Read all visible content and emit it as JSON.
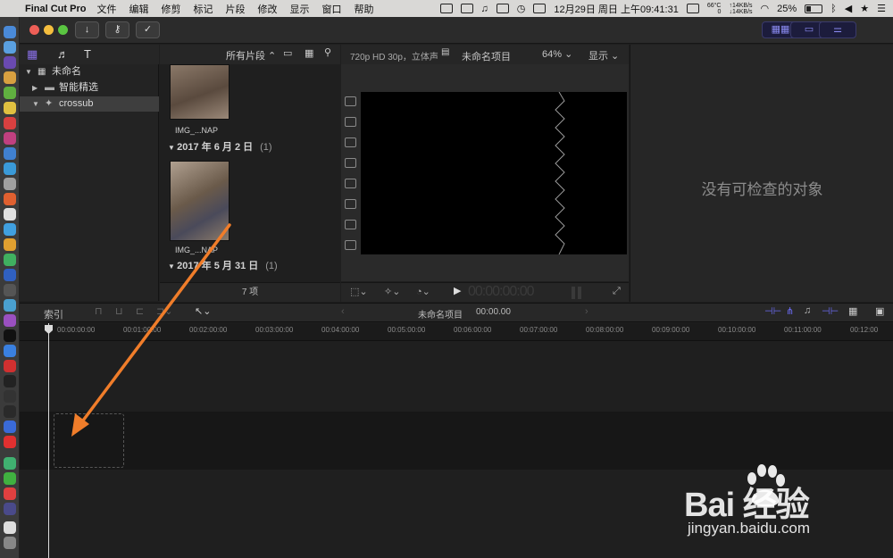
{
  "menubar": {
    "app_name": "Final Cut Pro",
    "items": [
      "文件",
      "编辑",
      "修剪",
      "标记",
      "片段",
      "修改",
      "显示",
      "窗口",
      "帮助"
    ],
    "temp": "66°C",
    "temp_sub": "0",
    "net_up": "↑14KB/s",
    "net_down": "↓14KB/s",
    "battery": "25%",
    "datetime": "12月29日 周日 上午09:41:31"
  },
  "toolbar": {
    "import_icon": "download-arrow-icon",
    "keywords_icon": "key-icon",
    "analyze_icon": "checkmark-circle-icon"
  },
  "libraries": {
    "library_name": "未命名",
    "smart_collections": "智能精选",
    "event_name": "crossub"
  },
  "browser": {
    "filter_label": "所有片段 ⌃",
    "clip1_caption": "IMG_...NAP",
    "date_group1": "2017 年 6 月 2 日",
    "date_group1_count": "(1)",
    "clip2_caption": "IMG_...NAP",
    "date_group2": "2017 年 5 月 31 日",
    "date_group2_count": "(1)",
    "item_count": "7 项"
  },
  "viewer": {
    "format": "720p HD 30p，立体声",
    "project_name": "未命名项目",
    "zoom": "64%",
    "display_menu": "显示",
    "timecode": "00:00:00:00"
  },
  "inspector": {
    "empty_message": "没有可检查的对象"
  },
  "timeline": {
    "index_label": "索引",
    "project_name": "未命名项目",
    "duration": "00:00.00",
    "ticks": [
      "00:00:00:00",
      "00:01:00:00",
      "00:02:00:00",
      "00:03:00:00",
      "00:04:00:00",
      "00:05:00:00",
      "00:06:00:00",
      "00:07:00:00",
      "00:08:00:00",
      "00:09:00:00",
      "00:10:00:00",
      "00:11:00:00",
      "00:12:00"
    ]
  },
  "watermark": {
    "brand": "Bai 经验",
    "url": "jingyan.baidu.com"
  },
  "colors": {
    "accent_blue": "#6a6af0",
    "annotation_orange": "#f07d2a"
  }
}
